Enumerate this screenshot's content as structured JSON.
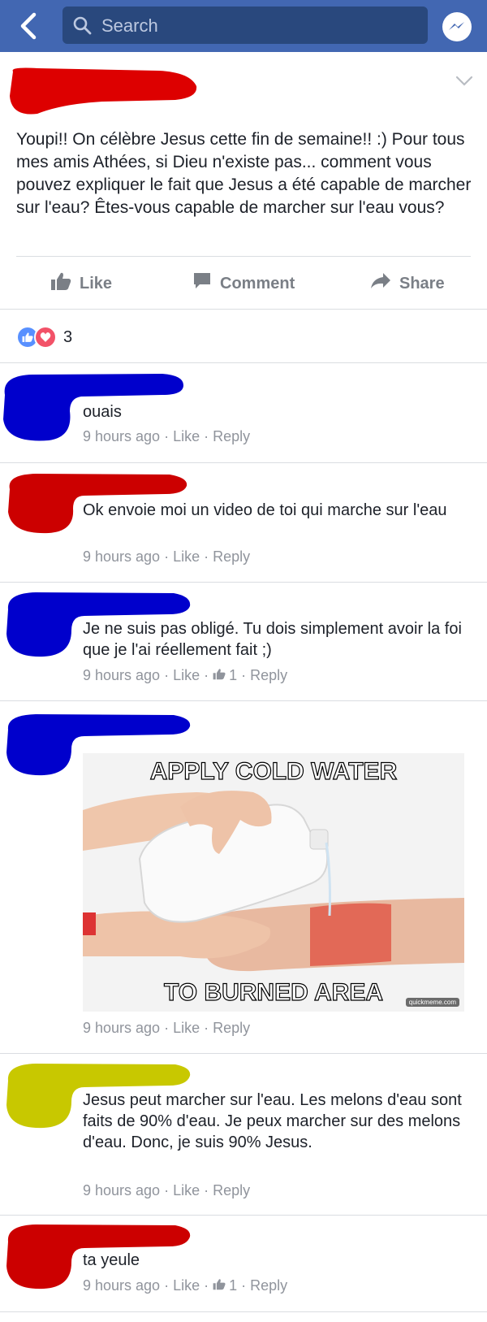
{
  "search": {
    "placeholder": "Search"
  },
  "post": {
    "text": "Youpi!! On célèbre Jesus cette fin de semaine!! :) Pour tous mes amis Athées, si Dieu n'existe pas... comment vous pouvez expliquer le fait que Jesus a été capable de marcher sur l'eau? Êtes-vous capable de marcher sur l'eau vous?"
  },
  "actions": {
    "like": "Like",
    "comment": "Comment",
    "share": "Share"
  },
  "reactions": {
    "count": "3"
  },
  "comments": [
    {
      "author_redaction_color": "#0000cc",
      "text": "ouais",
      "time": "9 hours ago",
      "like": "Like",
      "reply": "Reply"
    },
    {
      "author_redaction_color": "#cc0000",
      "text": "Ok envoie moi un video de toi qui marche sur l'eau",
      "time": "9 hours ago",
      "like": "Like",
      "reply": "Reply"
    },
    {
      "author_redaction_color": "#0000cc",
      "text": "Je ne suis pas obligé. Tu dois simplement avoir la foi que je l'ai réellement fait ;)",
      "time": "9 hours ago",
      "like": "Like",
      "like_count": "1",
      "reply": "Reply"
    },
    {
      "author_redaction_color": "#0000cc",
      "meme_top": "APPLY COLD WATER",
      "meme_bottom": "TO BURNED AREA",
      "meme_watermark": "quickmeme.com",
      "time": "9 hours ago",
      "like": "Like",
      "reply": "Reply"
    },
    {
      "author_redaction_color": "#c8c800",
      "text": "Jesus peut marcher sur l'eau. Les melons d'eau sont faits de 90% d'eau. Je peux marcher sur des melons d'eau. Donc, je suis 90% Jesus.",
      "time": "9 hours ago",
      "like": "Like",
      "reply": "Reply"
    },
    {
      "author_redaction_color": "#cc0000",
      "text": "ta yeule",
      "time": "9 hours ago",
      "like": "Like",
      "like_count": "1",
      "reply": "Reply"
    }
  ],
  "colors": {
    "header": "#4267b2",
    "search_bg": "#29487d",
    "meta": "#90949c",
    "action": "#7a7f86"
  }
}
